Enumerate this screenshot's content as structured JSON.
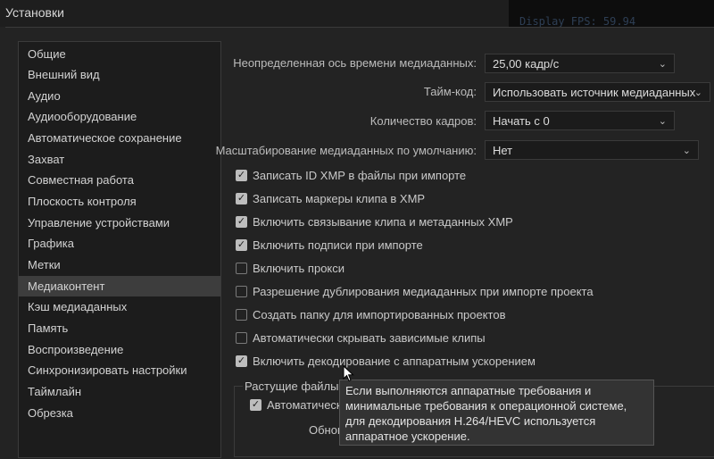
{
  "window": {
    "title": "Установки"
  },
  "background_text": "Display FPS: 59.94",
  "sidebar": {
    "items": [
      {
        "label": "Общие"
      },
      {
        "label": "Внешний вид"
      },
      {
        "label": "Аудио"
      },
      {
        "label": "Аудиооборудование"
      },
      {
        "label": "Автоматическое сохранение"
      },
      {
        "label": "Захват"
      },
      {
        "label": "Совместная работа"
      },
      {
        "label": "Плоскость контроля"
      },
      {
        "label": "Управление устройствами"
      },
      {
        "label": "Графика"
      },
      {
        "label": "Метки"
      },
      {
        "label": "Медиаконтент"
      },
      {
        "label": "Кэш медиаданных"
      },
      {
        "label": "Память"
      },
      {
        "label": "Воспроизведение"
      },
      {
        "label": "Синхронизировать настройки"
      },
      {
        "label": "Таймлайн"
      },
      {
        "label": "Обрезка"
      }
    ],
    "selected": "Медиаконтент"
  },
  "fields": {
    "timebase": {
      "label": "Неопределенная ось времени медиаданных:",
      "value": "25,00 кадр/с"
    },
    "timecode": {
      "label": "Тайм-код:",
      "value": "Использовать источник медиаданных"
    },
    "frame_count": {
      "label": "Количество кадров:",
      "value": "Начать с 0"
    },
    "scaling": {
      "label": "Масштабирование медиаданных по умолчанию:",
      "value": "Нет"
    }
  },
  "checkboxes": [
    {
      "label": "Записать ID XMP в файлы при импорте",
      "checked": true
    },
    {
      "label": "Записать маркеры клипа в XMP",
      "checked": true
    },
    {
      "label": "Включить связывание клипа и метаданных XMP",
      "checked": true
    },
    {
      "label": "Включить подписи при импорте",
      "checked": true
    },
    {
      "label": "Включить прокси",
      "checked": false
    },
    {
      "label": "Разрешение дублирования медиаданных при импорте проекта",
      "checked": false
    },
    {
      "label": "Создать папку для импортированных проектов",
      "checked": false
    },
    {
      "label": "Автоматически скрывать зависимые клипы",
      "checked": false
    },
    {
      "label": "Включить декодирование с аппаратным ускорением",
      "checked": true
    }
  ],
  "growing_files": {
    "title": "Растущие файлы",
    "auto_label": "Автоматически",
    "auto_checked": true,
    "refresh_label": "Обнов"
  },
  "tooltip": {
    "text": "Если выполняются аппаратные требования и минимальные требования к операционной системе, для декодирования H.264/HEVC используется аппаратное ускорение."
  },
  "colors": {
    "background": "#232323",
    "sidebar_bg": "#1c1c1c",
    "selected_bg": "#3d3d3d",
    "tooltip_bg": "#333333"
  }
}
